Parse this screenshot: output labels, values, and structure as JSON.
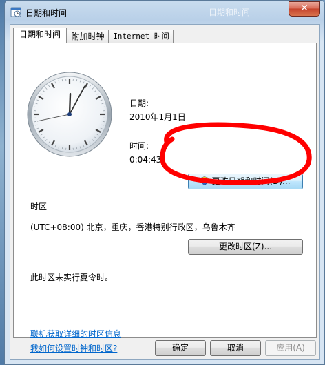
{
  "window": {
    "title": "日期和时间",
    "ghost_title": "日期和时间",
    "close_glyph": "✕"
  },
  "tabs": [
    {
      "label": "日期和时间",
      "active": true
    },
    {
      "label": "附加时钟",
      "active": false
    },
    {
      "label": "Internet 时间",
      "active": false
    }
  ],
  "datetime": {
    "date_label": "日期:",
    "date_value": "2010年1月1日",
    "time_label": "时间:",
    "time_value": "0:04:43",
    "change_button": "更改日期和时间(D)..."
  },
  "timezone": {
    "section_label": "时区",
    "value": "(UTC+08:00) 北京，重庆，香港特别行政区，乌鲁木齐",
    "change_button": "更改时区(Z)...",
    "dst_note": "此时区未实行夏令时。"
  },
  "links": {
    "online_info": "联机获取详细的时区信息",
    "howto": "我如何设置时钟和时区?"
  },
  "footer": {
    "ok": "确定",
    "cancel": "取消",
    "apply": "应用(A)"
  },
  "clock": {
    "hour": 0,
    "minute": 4,
    "second": 43
  },
  "colors": {
    "link": "#0066cc",
    "annotation_ring": "#ff0000"
  }
}
